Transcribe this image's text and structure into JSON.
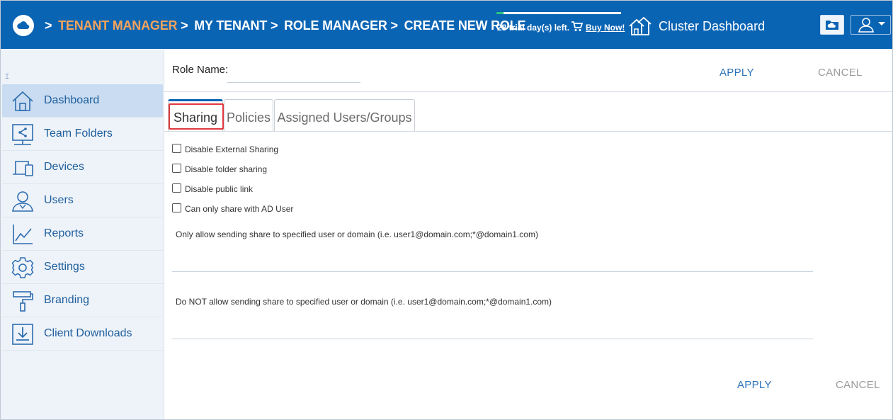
{
  "header": {
    "breadcrumb": [
      {
        "label": "TENANT MANAGER",
        "color": "#f3a35c"
      },
      {
        "label": "MY TENANT",
        "color": "#ffffff"
      },
      {
        "label": "ROLE MANAGER",
        "color": "#ffffff"
      },
      {
        "label": "CREATE NEW ROLE",
        "color": "#ffffff"
      }
    ],
    "separator": ">",
    "trial_text": "28 trial day(s) left.",
    "buy_now": "Buy Now!",
    "cluster_dashboard": "Cluster Dashboard",
    "icons": {
      "logo": "cloud-logo-icon",
      "cart": "shopping-cart-icon",
      "cluster": "cluster-houses-icon",
      "folder": "cloud-folder-icon",
      "user": "user-menu-icon"
    },
    "bg_color": "#0a64b4"
  },
  "sidebar": {
    "collapse_glyph": "⌶",
    "items": [
      {
        "label": "Dashboard",
        "icon": "home-icon",
        "active": true
      },
      {
        "label": "Team Folders",
        "icon": "team-folder-icon",
        "active": false
      },
      {
        "label": "Devices",
        "icon": "devices-icon",
        "active": false
      },
      {
        "label": "Users",
        "icon": "users-icon",
        "active": false
      },
      {
        "label": "Reports",
        "icon": "reports-icon",
        "active": false
      },
      {
        "label": "Settings",
        "icon": "gear-icon",
        "active": false
      },
      {
        "label": "Branding",
        "icon": "paint-roller-icon",
        "active": false
      },
      {
        "label": "Client Downloads",
        "icon": "download-icon",
        "active": false
      }
    ]
  },
  "role": {
    "label": "Role Name:",
    "value": "",
    "apply": "APPLY",
    "cancel": "CANCEL"
  },
  "tabs": [
    {
      "label": "Sharing",
      "active": true
    },
    {
      "label": "Policies",
      "active": false
    },
    {
      "label": "Assigned Users/Groups",
      "active": false
    }
  ],
  "sharing": {
    "checkboxes": [
      {
        "label": "Disable External Sharing",
        "checked": false
      },
      {
        "label": "Disable folder sharing",
        "checked": false
      },
      {
        "label": "Disable public link",
        "checked": false
      },
      {
        "label": "Can only share with AD User",
        "checked": false
      }
    ],
    "allow_label": "Only allow sending share to specified user or domain (i.e. user1@domain.com;*@domain1.com)",
    "allow_value": "",
    "deny_label": "Do NOT allow sending share to specified user or domain (i.e. user1@domain.com;*@domain1.com)",
    "deny_value": ""
  },
  "footer": {
    "apply": "APPLY",
    "cancel": "CANCEL"
  },
  "colors": {
    "accent": "#0a64b4",
    "link": "#2b73b9",
    "highlight": "#e0393e"
  }
}
